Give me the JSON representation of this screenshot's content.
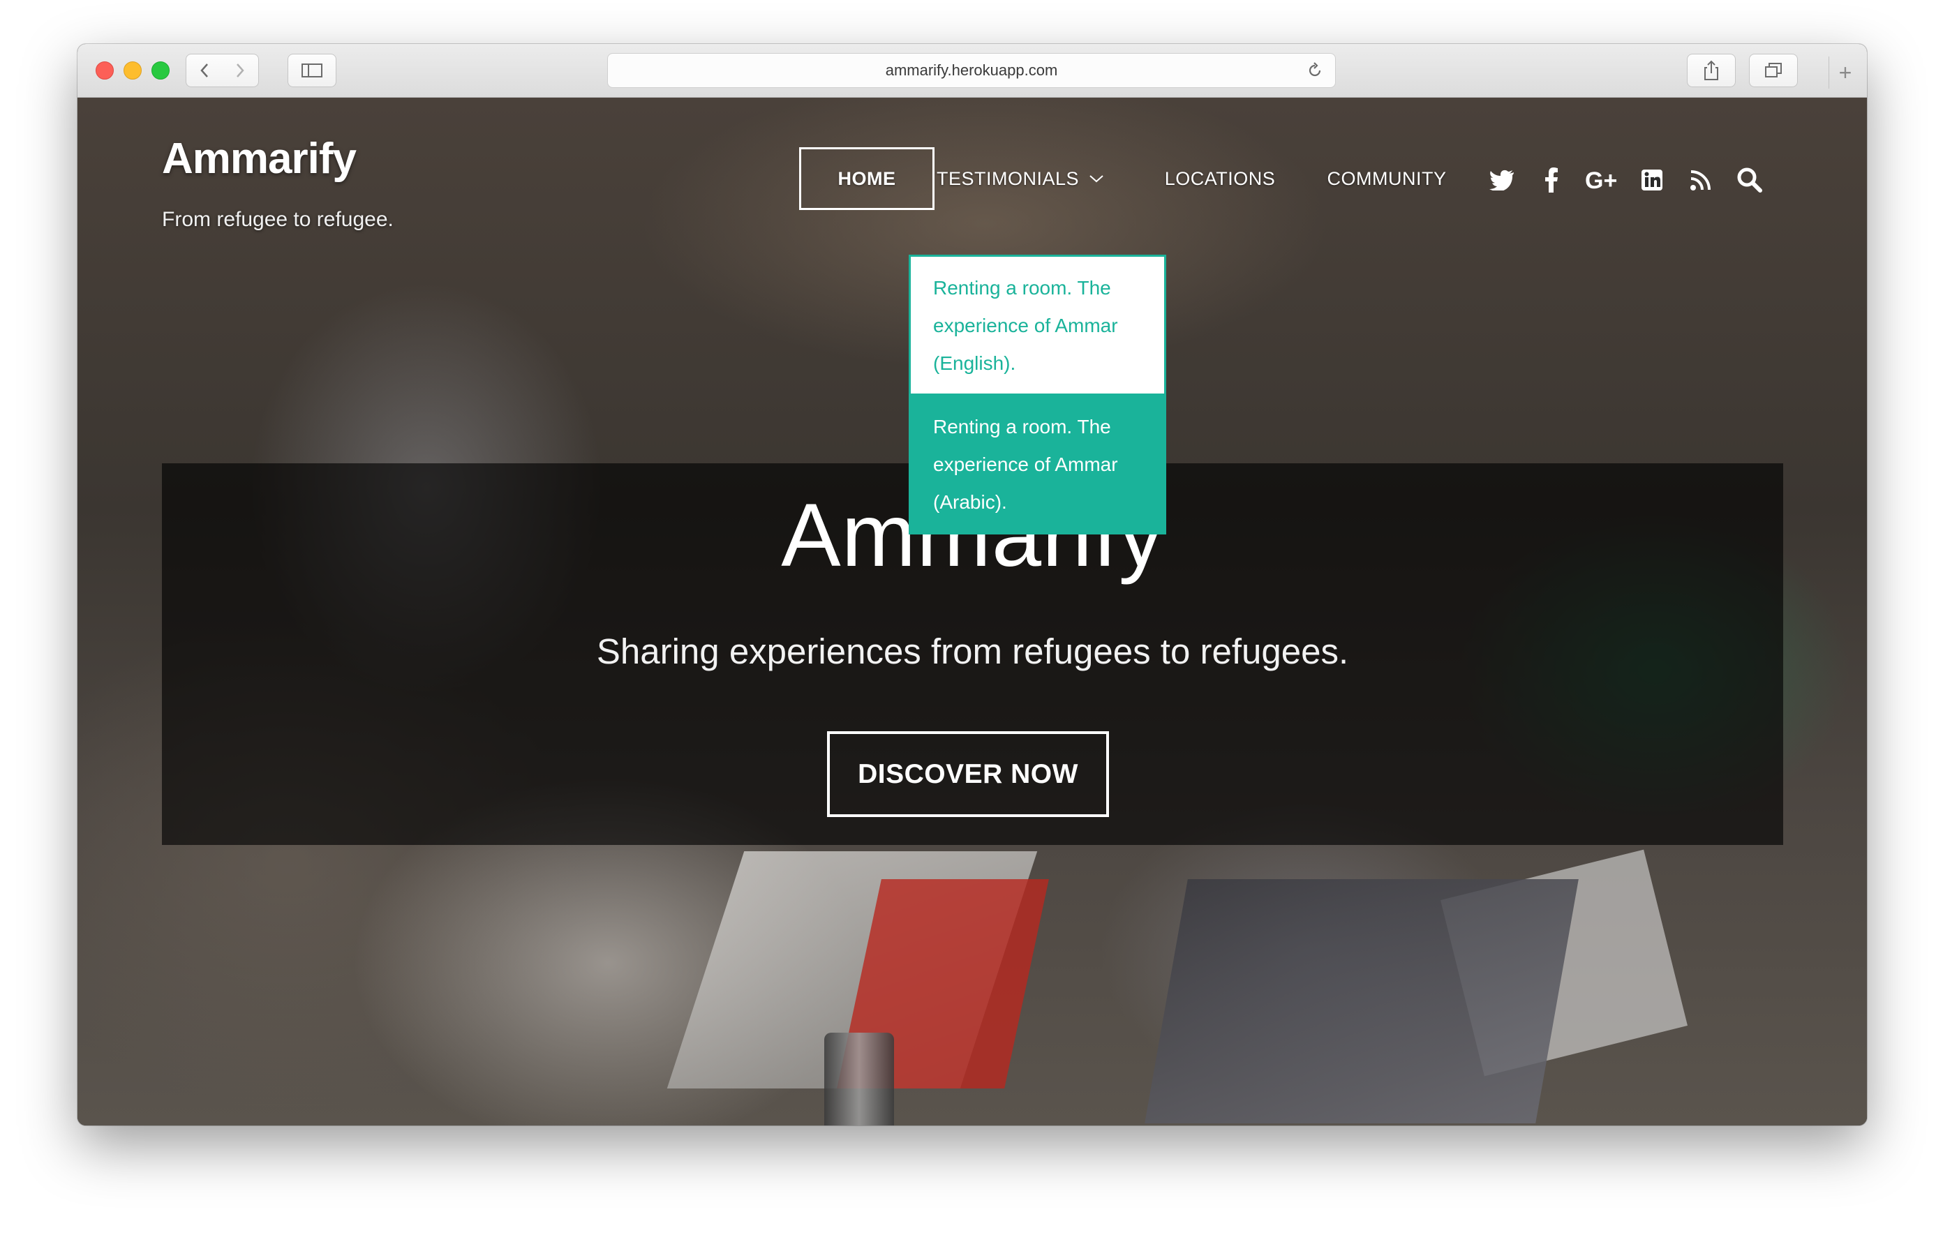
{
  "browser": {
    "url": "ammarify.herokuapp.com"
  },
  "site": {
    "brand": "Ammarify",
    "tagline": "From refugee to refugee."
  },
  "nav": {
    "home": "HOME",
    "testimonials": "TESTIMONIALS",
    "locations": "LOCATIONS",
    "community": "COMMUNITY"
  },
  "social_icons": [
    "twitter-icon",
    "facebook-icon",
    "google-plus-icon",
    "linkedin-icon",
    "rss-icon",
    "search-icon"
  ],
  "dropdown": {
    "items": [
      {
        "label": "Renting a room. The experience of Ammar (English)."
      },
      {
        "label": "Renting a room. The experience of Ammar (Arabic)."
      }
    ]
  },
  "hero": {
    "title": "Ammarify",
    "subtitle": "Sharing experiences from refugees to refugees.",
    "cta": "DISCOVER NOW"
  },
  "colors": {
    "accent": "#1ab39a",
    "overlay": "#000000",
    "text": "#ffffff"
  }
}
